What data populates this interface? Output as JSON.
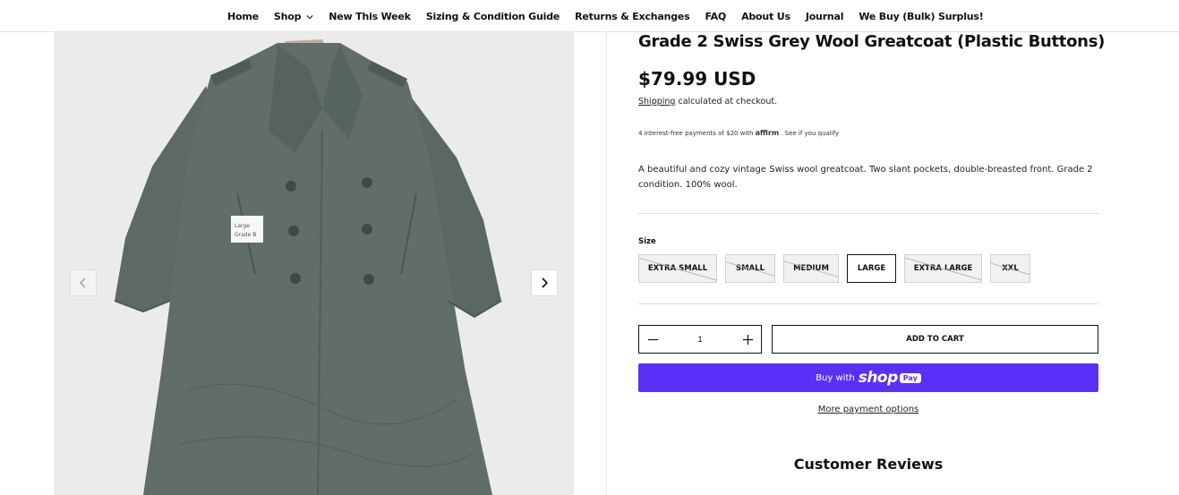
{
  "nav": {
    "items": [
      {
        "label": "Home"
      },
      {
        "label": "Shop",
        "has_dropdown": true
      },
      {
        "label": "New This Week"
      },
      {
        "label": "Sizing & Condition Guide"
      },
      {
        "label": "Returns & Exchanges"
      },
      {
        "label": "FAQ"
      },
      {
        "label": "About Us"
      },
      {
        "label": "Journal"
      },
      {
        "label": "We Buy (Bulk) Surplus!"
      }
    ]
  },
  "gallery": {
    "prev_icon": "chevron-left-icon",
    "next_icon": "chevron-right-icon",
    "tag_line1": "Large",
    "tag_line2": "Grade B"
  },
  "product": {
    "title": "Grade 2 Swiss Grey Wool Greatcoat (Plastic Buttons)",
    "price": "$79.99 USD",
    "shipping_link": "Shipping",
    "shipping_text": "calculated at checkout.",
    "affirm_pre": "4 interest-free payments of $20 with",
    "affirm_logo": "affirm",
    "affirm_link": "See if you qualify",
    "description": "A beautiful and cozy vintage Swiss wool greatcoat. Two slant pockets, double-breasted front. Grade 2 condition. 100% wool.",
    "size_label": "Size",
    "sizes": [
      {
        "label": "EXTRA SMALL",
        "available": false
      },
      {
        "label": "SMALL",
        "available": false
      },
      {
        "label": "MEDIUM",
        "available": false
      },
      {
        "label": "LARGE",
        "available": true,
        "selected": true
      },
      {
        "label": "EXTRA LARGE",
        "available": false
      },
      {
        "label": "XXL",
        "available": false
      }
    ],
    "quantity": "1",
    "add_to_cart": "ADD TO CART",
    "shop_pay_prefix": "Buy with",
    "shop_pay_brand": "shop",
    "shop_pay_badge": "Pay",
    "more_payment": "More payment options",
    "reviews_heading": "Customer Reviews"
  },
  "colors": {
    "shop_pay": "#5a31f4",
    "coat": "#5f6b66",
    "background": "#ffffff"
  }
}
